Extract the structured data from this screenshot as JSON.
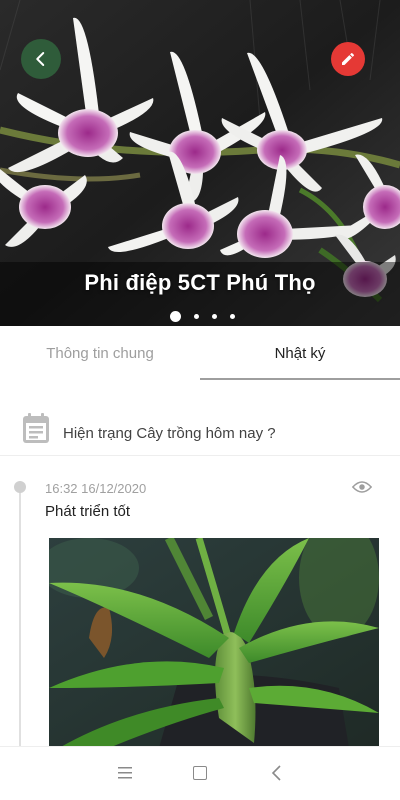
{
  "header": {
    "title": "Phi điệp 5CT Phú Thọ",
    "back_icon": "arrow-left-icon",
    "edit_icon": "pencil-icon",
    "carousel_count": 4,
    "carousel_active": 1
  },
  "tabs": [
    {
      "label": "Thông tin chung",
      "active": false
    },
    {
      "label": "Nhật ký",
      "active": true
    }
  ],
  "today_status": {
    "icon": "calendar-icon",
    "label": "Hiện trạng Cây trồng hôm nay ?"
  },
  "entries": [
    {
      "time": "16:32 16/12/2020",
      "text": "Phát triển tốt",
      "view_icon": "eye-icon"
    }
  ],
  "navbar": {
    "menu_icon": "menu-icon",
    "home_icon": "home-square-icon",
    "back_icon": "back-chevron-icon"
  },
  "colors": {
    "back_button": "#2f5c3a",
    "edit_button": "#e53935",
    "timeline": "#e0e0e0"
  }
}
